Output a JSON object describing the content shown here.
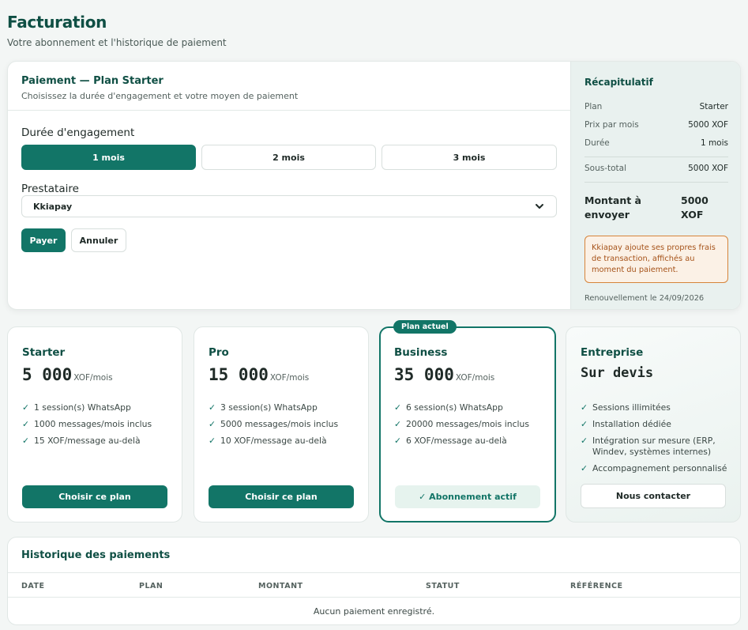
{
  "page": {
    "title": "Facturation",
    "subtitle": "Votre abonnement et l'historique de paiement"
  },
  "payment": {
    "title": "Paiement — Plan Starter",
    "description": "Choisissez la durée d'engagement et votre moyen de paiement",
    "duration_label": "Durée d'engagement",
    "durations": [
      "1 mois",
      "2 mois",
      "3 mois"
    ],
    "selected_duration": "1 mois",
    "provider_label": "Prestataire",
    "provider_value": "Kkiapay",
    "pay_button": "Payer",
    "cancel_button": "Annuler"
  },
  "summary": {
    "title": "Récapitulatif",
    "rows": [
      {
        "label": "Plan",
        "value": "Starter"
      },
      {
        "label": "Prix par mois",
        "value": "5000 XOF"
      },
      {
        "label": "Durée",
        "value": "1 mois"
      },
      {
        "label": "Sous-total",
        "value": "5000 XOF"
      }
    ],
    "total_label": "Montant à envoyer",
    "total_value": "5000 XOF",
    "warning": "Kkiapay ajoute ses propres frais de transaction, affichés au moment du paiement.",
    "renewal": "Renouvellement le 24/09/2026"
  },
  "plans": [
    {
      "name": "Starter",
      "price": "5 000",
      "unit": "XOF/mois",
      "features": [
        "1 session(s) WhatsApp",
        "1000 messages/mois inclus",
        "15 XOF/message au-delà"
      ],
      "button": "Choisir ce plan"
    },
    {
      "name": "Pro",
      "price": "15 000",
      "unit": "XOF/mois",
      "features": [
        "3 session(s) WhatsApp",
        "5000 messages/mois inclus",
        "10 XOF/message au-delà"
      ],
      "button": "Choisir ce plan"
    },
    {
      "name": "Business",
      "price": "35 000",
      "unit": "XOF/mois",
      "badge": "Plan actuel",
      "features": [
        "6 session(s) WhatsApp",
        "20000 messages/mois inclus",
        "6 XOF/message au-delà"
      ],
      "button": "✓ Abonnement actif"
    },
    {
      "name": "Entreprise",
      "price": "Sur devis",
      "features": [
        "Sessions illimitées",
        "Installation dédiée",
        "Intégration sur mesure (ERP, Windev, systèmes internes)",
        "Accompagnement personnalisé"
      ],
      "button": "Nous contacter"
    }
  ],
  "check_glyph": "✓",
  "history": {
    "title": "Historique des paiements",
    "columns": [
      "DATE",
      "PLAN",
      "MONTANT",
      "STATUT",
      "RÉFÉRENCE"
    ],
    "empty_text": "Aucun paiement enregistré."
  },
  "colors": {
    "accent": "#127567",
    "heading": "#0f4f44",
    "warning_border": "#d6843a",
    "warning_text": "#a6531a"
  }
}
